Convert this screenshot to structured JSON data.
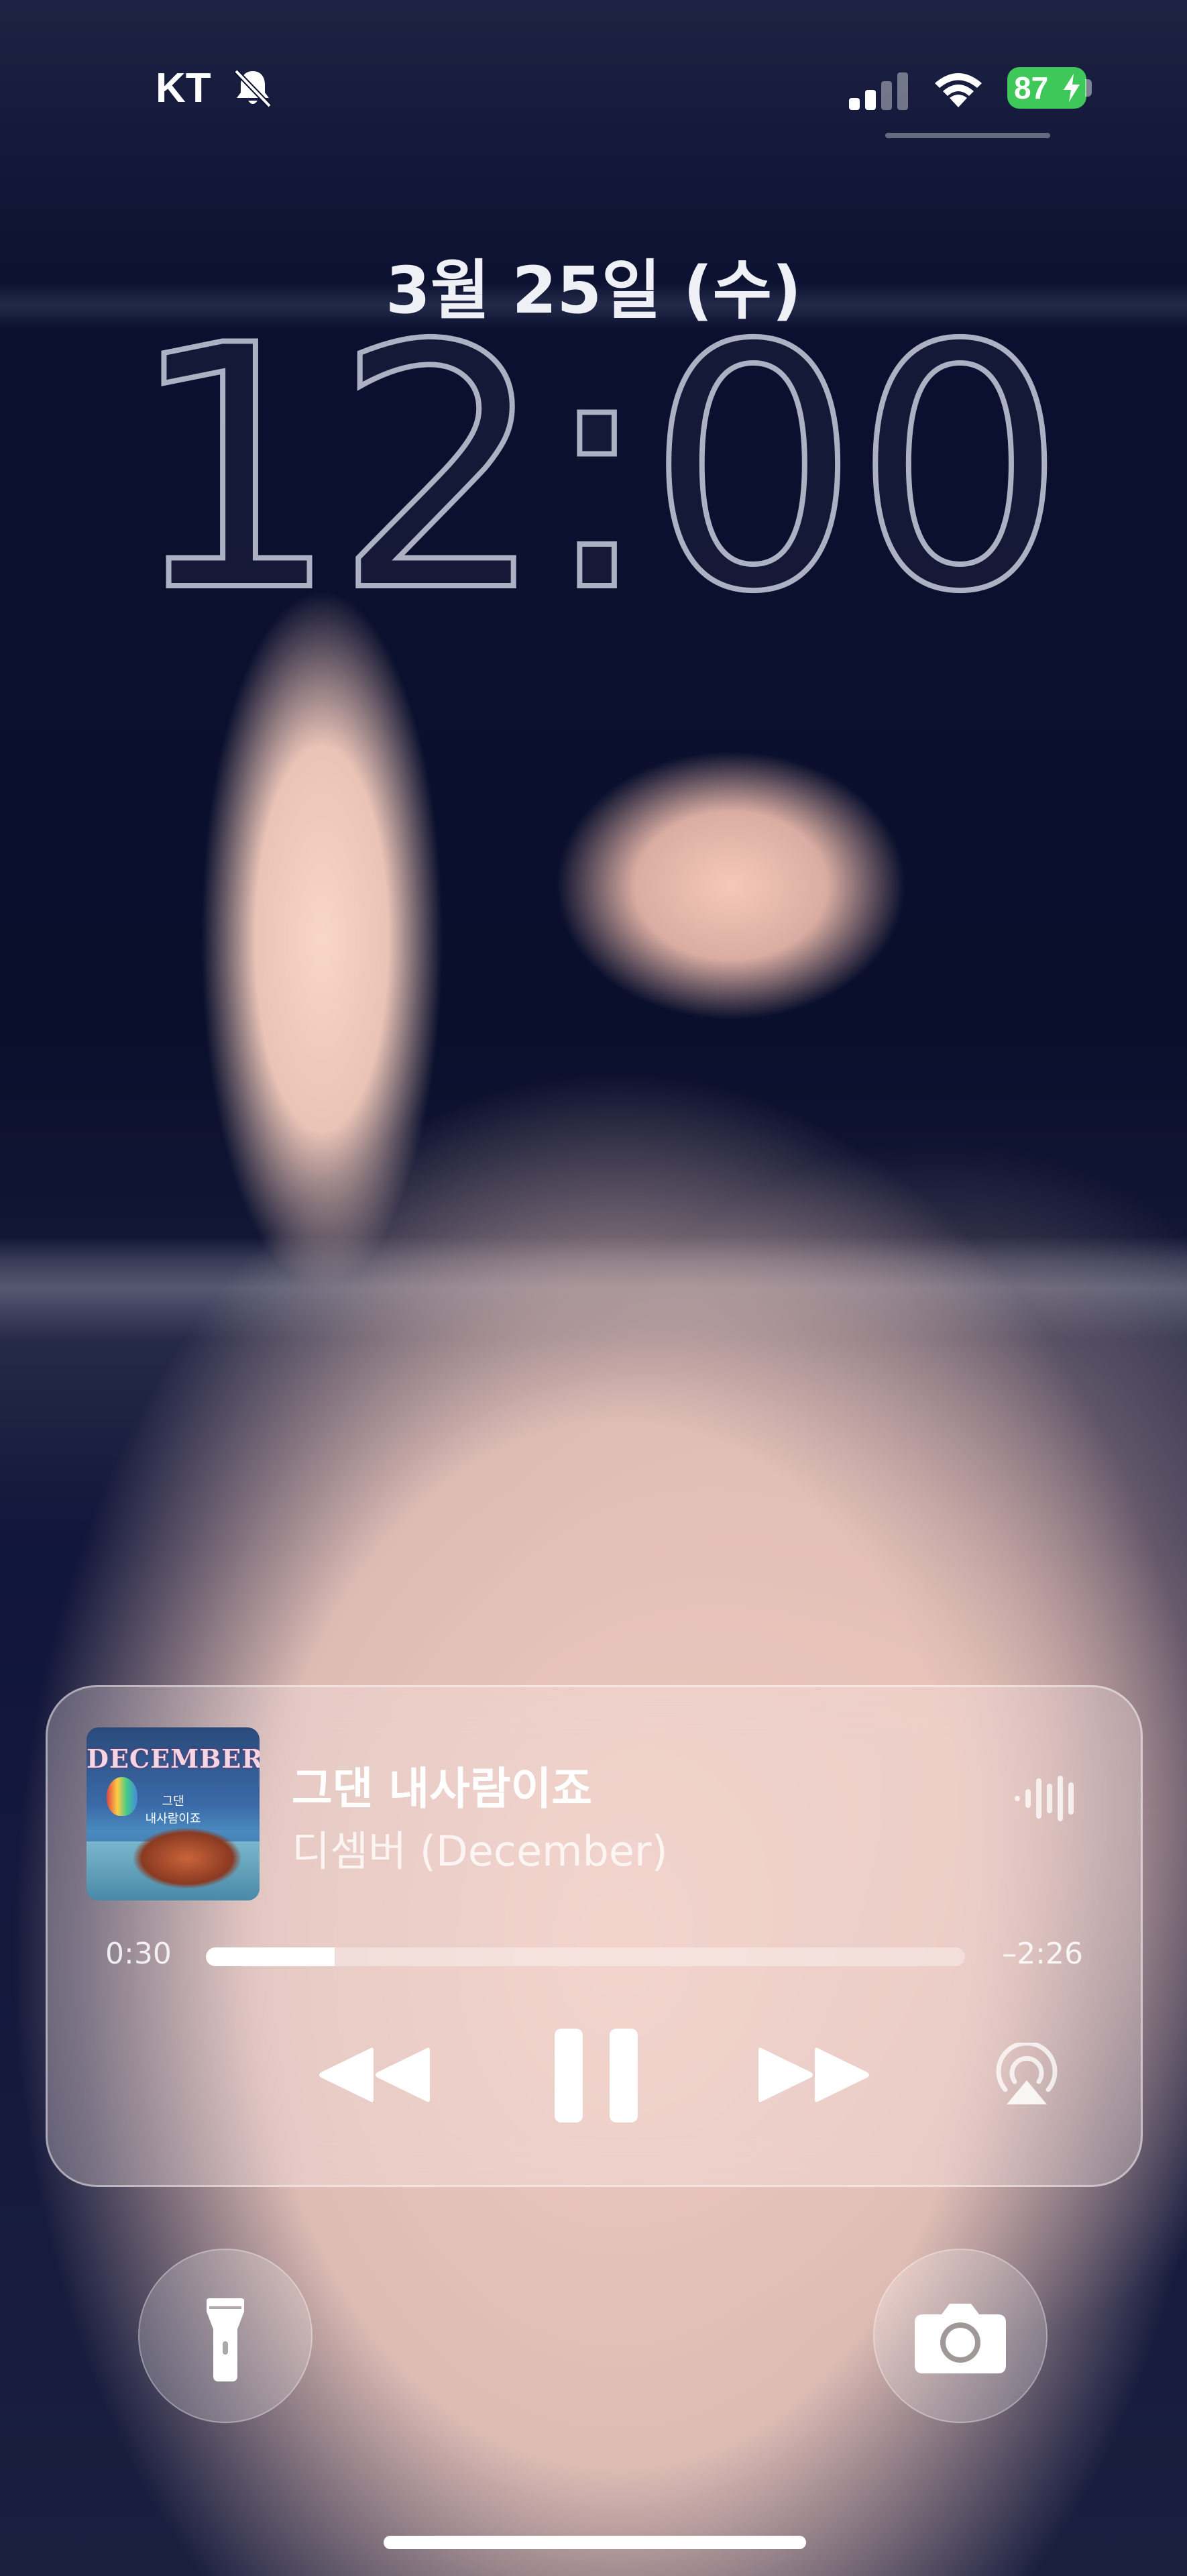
{
  "status_bar": {
    "carrier": "KT",
    "battery_percent": "87",
    "battery_color": "#3fc85a",
    "icons": [
      "bell-slash-icon",
      "cellular-signal-icon",
      "wifi-icon",
      "battery-charging-icon"
    ]
  },
  "lock_screen": {
    "date": "3월 25일 (수)",
    "time": "12:00"
  },
  "now_playing": {
    "album_art": {
      "title": "DECEMBER",
      "subtitle_line1": "그댄",
      "subtitle_line2": "내사람이죠"
    },
    "track_title": "그댄 내사람이죠",
    "artist": "디셈버 (December)",
    "elapsed": "0:30",
    "remaining": "–2:26",
    "progress_fraction": 0.17,
    "controls": [
      "rewind-icon",
      "pause-icon",
      "fast-forward-icon",
      "airplay-icon"
    ]
  },
  "quick_actions": [
    "flashlight-icon",
    "camera-icon"
  ]
}
